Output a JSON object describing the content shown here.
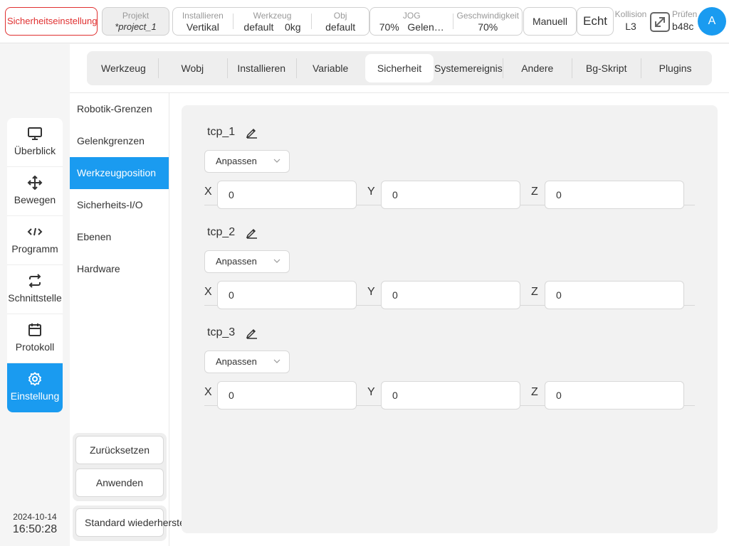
{
  "topbar": {
    "safety_label": "Sicherheitseinstellung",
    "project": {
      "label": "Projekt",
      "value": "*project_1"
    },
    "install": {
      "label": "Installieren",
      "value": "Vertikal"
    },
    "tool": {
      "label": "Werkzeug",
      "value1": "default",
      "value2": "0kg"
    },
    "obj": {
      "label": "Obj",
      "value": "default"
    },
    "jog": {
      "label": "JOG",
      "value1": "70%",
      "value2": "Gelen…"
    },
    "speed": {
      "label": "Geschwindigkeit",
      "value": "70%"
    },
    "mode": "Manuell",
    "real": "Echt",
    "collision": {
      "label": "Kollision",
      "value": "L3"
    },
    "check": {
      "label": "Prüfen",
      "value": "b48c"
    },
    "avatar": "A"
  },
  "nav": {
    "items": [
      {
        "label": "Überblick",
        "icon": "monitor-icon"
      },
      {
        "label": "Bewegen",
        "icon": "move-icon"
      },
      {
        "label": "Programm",
        "icon": "code-icon"
      },
      {
        "label": "Schnittstelle",
        "icon": "swap-icon"
      },
      {
        "label": "Protokoll",
        "icon": "calendar-icon"
      },
      {
        "label": "Einstellung",
        "icon": "gear-icon"
      }
    ],
    "active": "Einstellung"
  },
  "datetime": {
    "date": "2024-10-14",
    "time": "16:50:28"
  },
  "tabs": [
    "Werkzeug",
    "Wobj",
    "Installieren",
    "Variable",
    "Sicherheit",
    "Systemereignis",
    "Andere",
    "Bg-Skript",
    "Plugins"
  ],
  "active_tab": "Sicherheit",
  "subnav": {
    "items": [
      "Robotik-Grenzen",
      "Gelenkgrenzen",
      "Werkzeugposition",
      "Sicherheits-I/O",
      "Ebenen",
      "Hardware"
    ],
    "active": "Werkzeugposition"
  },
  "actions": {
    "reset": "Zurücksetzen",
    "apply": "Anwenden",
    "restore": "Standard wiederherstellen"
  },
  "tcps": [
    {
      "name": "tcp_1",
      "mode": "Anpassen",
      "x_label": "X",
      "y_label": "Y",
      "z_label": "Z",
      "x": "0",
      "y": "0",
      "z": "0"
    },
    {
      "name": "tcp_2",
      "mode": "Anpassen",
      "x_label": "X",
      "y_label": "Y",
      "z_label": "Z",
      "x": "0",
      "y": "0",
      "z": "0"
    },
    {
      "name": "tcp_3",
      "mode": "Anpassen",
      "x_label": "X",
      "y_label": "Y",
      "z_label": "Z",
      "x": "0",
      "y": "0",
      "z": "0"
    }
  ],
  "colors": {
    "accent": "#1a9bf0",
    "danger": "#e03030"
  }
}
